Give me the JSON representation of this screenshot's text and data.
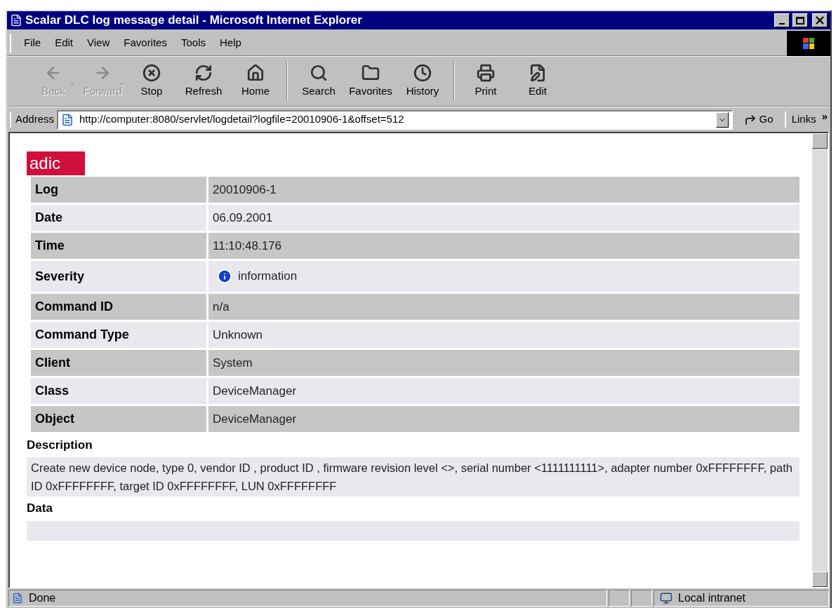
{
  "window": {
    "title": "Scalar DLC log message detail - Microsoft Internet Explorer"
  },
  "menu": [
    {
      "label": "File"
    },
    {
      "label": "Edit"
    },
    {
      "label": "View"
    },
    {
      "label": "Favorites"
    },
    {
      "label": "Tools"
    },
    {
      "label": "Help"
    }
  ],
  "toolbar": [
    {
      "kind": "back",
      "label": "Back",
      "disabled": true,
      "dropdown": true
    },
    {
      "kind": "forward",
      "label": "Forward",
      "disabled": true,
      "dropdown": true
    },
    {
      "kind": "stop",
      "label": "Stop",
      "disabled": false,
      "dropdown": false
    },
    {
      "kind": "refresh",
      "label": "Refresh",
      "disabled": false,
      "dropdown": false
    },
    {
      "kind": "home",
      "label": "Home",
      "disabled": false,
      "dropdown": false
    },
    {
      "kind": "separator"
    },
    {
      "kind": "search",
      "label": "Search",
      "disabled": false,
      "dropdown": false
    },
    {
      "kind": "favorites",
      "label": "Favorites",
      "disabled": false,
      "dropdown": false
    },
    {
      "kind": "history",
      "label": "History",
      "disabled": false,
      "dropdown": false
    },
    {
      "kind": "separator"
    },
    {
      "kind": "print",
      "label": "Print",
      "disabled": false,
      "dropdown": false
    },
    {
      "kind": "edit",
      "label": "Edit",
      "disabled": false,
      "dropdown": false
    }
  ],
  "address": {
    "label": "Address",
    "value": "http://computer:8080/servlet/logdetail?logfile=20010906-1&offset=512",
    "go": "Go",
    "links": "Links",
    "more": "»"
  },
  "page": {
    "logo": "adic",
    "fields": [
      {
        "label": "Log",
        "value": "20010906-1"
      },
      {
        "label": "Date",
        "value": "06.09.2001"
      },
      {
        "label": "Time",
        "value": "11:10:48.176"
      },
      {
        "label": "Severity",
        "value": "information",
        "kind": "info"
      },
      {
        "label": "Command ID",
        "value": "n/a"
      },
      {
        "label": "Command Type",
        "value": "Unknown"
      },
      {
        "label": "Client",
        "value": "System"
      },
      {
        "label": "Class",
        "value": "DeviceManager"
      },
      {
        "label": "Object",
        "value": "DeviceManager"
      }
    ],
    "description": {
      "label": "Description",
      "text": "Create new device node, type 0, vendor ID , product ID , firmware revision level <>, serial number <1111111111>, adapter number 0xFFFFFFFF, path ID 0xFFFFFFFF, target ID 0xFFFFFFFF, LUN 0xFFFFFFFF"
    },
    "data": {
      "label": "Data"
    }
  },
  "status_bar": {
    "text": "Done",
    "zone": "Local intranet"
  }
}
